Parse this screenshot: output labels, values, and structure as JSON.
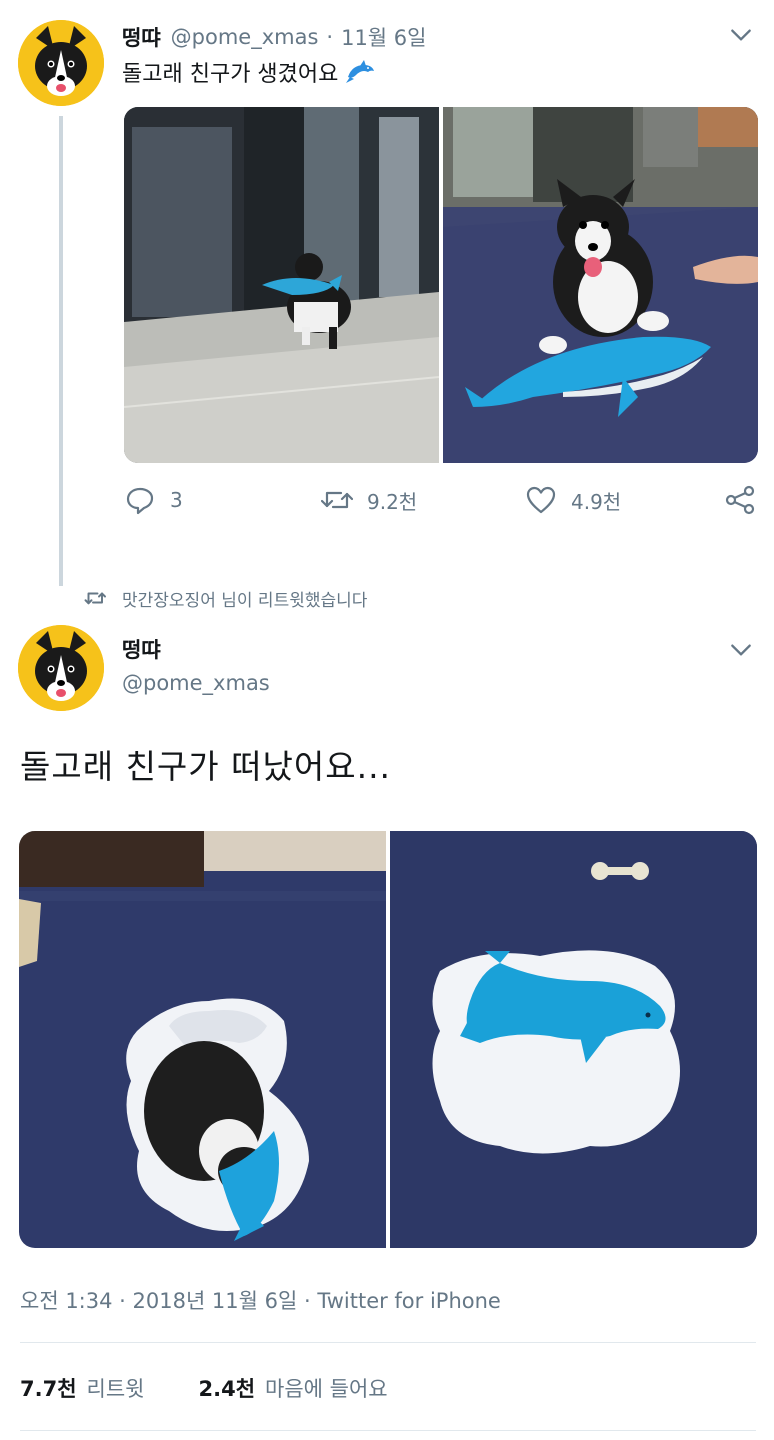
{
  "tweet1": {
    "name": "떵땨",
    "handle": "@pome_xmas",
    "separator": "·",
    "date": "11월 6일",
    "text": "돌고래 친구가 생겼어요",
    "emoji": "dolphin-icon",
    "images": [
      {
        "label": "dog-carrying-dolphin-toy"
      },
      {
        "label": "dog-with-dolphin-toy-on-rug"
      }
    ],
    "actions": {
      "replies": "3",
      "retweets": "9.2천",
      "likes": "4.9천"
    }
  },
  "retweet_note": {
    "text": "맛간장오징어 님이 리트윗했습니다"
  },
  "tweet2": {
    "name": "떵땨",
    "handle": "@pome_xmas",
    "text": "돌고래 친구가 떠났어요...",
    "images": [
      {
        "label": "dog-with-torn-stuffing"
      },
      {
        "label": "flattened-dolphin-on-stuffing"
      }
    ],
    "meta": "오전 1:34 · 2018년 11월 6일 · Twitter for iPhone",
    "stats": {
      "retweets_count": "7.7천",
      "retweets_label": "리트윗",
      "likes_count": "2.4천",
      "likes_label": "마음에 들어요"
    }
  },
  "colors": {
    "text_primary": "#14171a",
    "text_secondary": "#657786",
    "thread_line": "#ccd6dd",
    "avatar_bg": "#f6c21a",
    "toy_blue": "#1aa3d6",
    "rug_navy": "#2b3566"
  }
}
